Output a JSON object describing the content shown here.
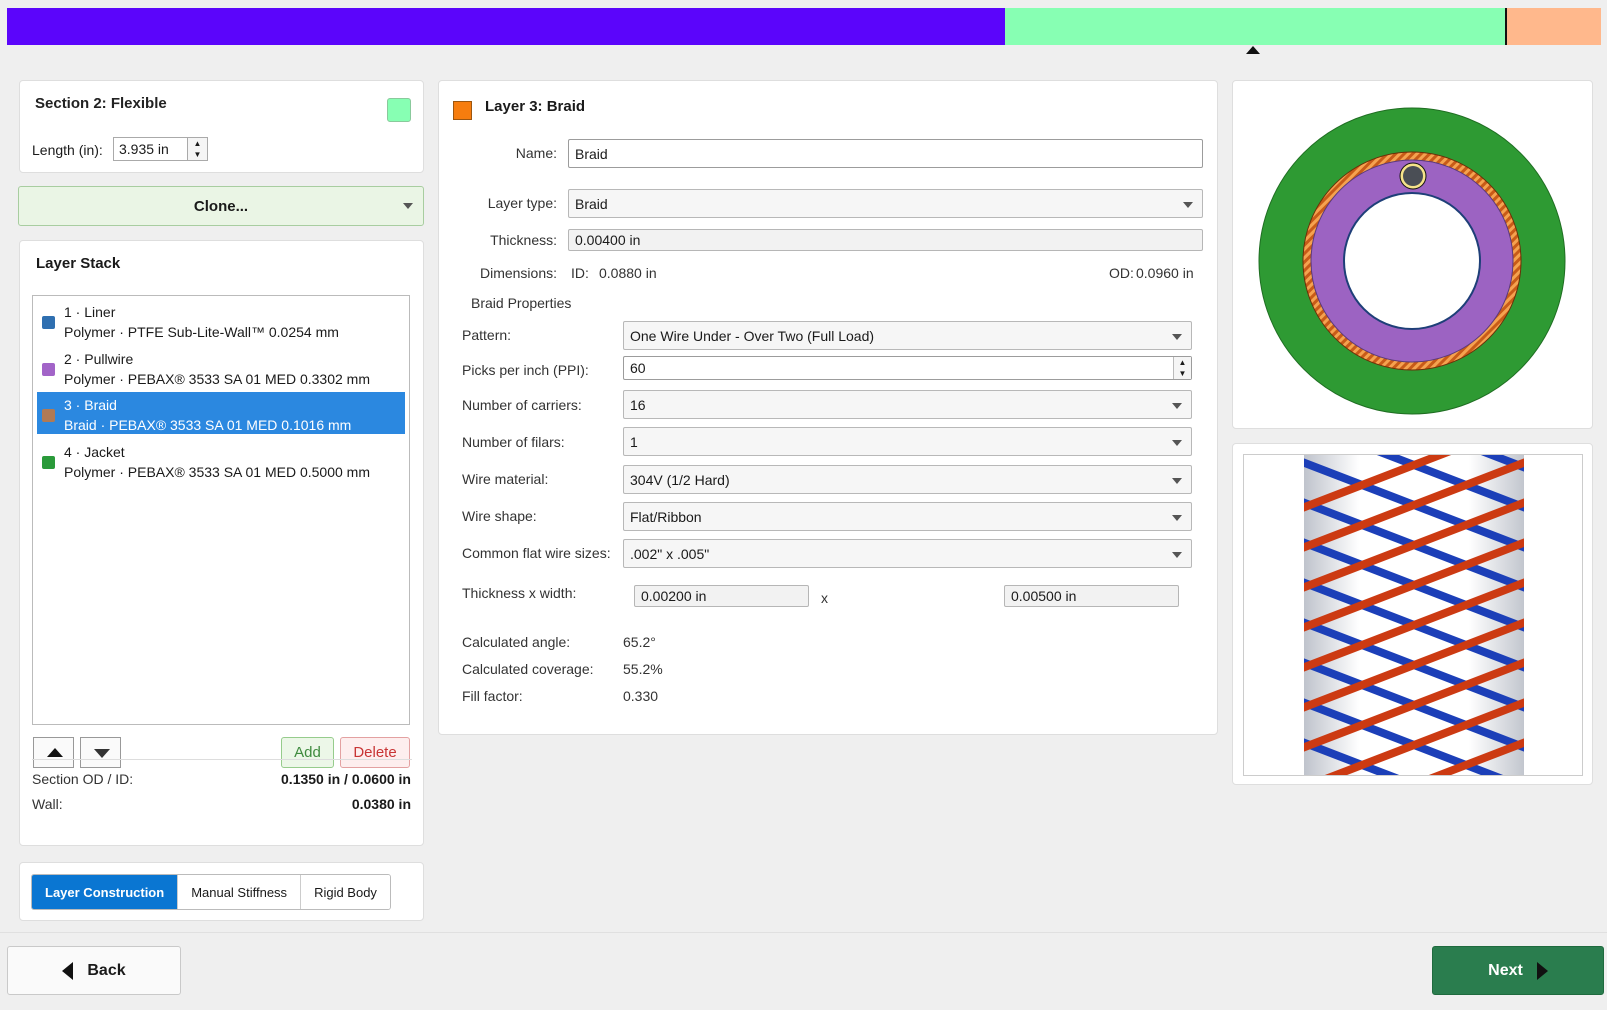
{
  "progress": {
    "segments": [
      {
        "color": "#5b05fb"
      },
      {
        "color": "#87ffb3"
      },
      {
        "color": "#ffb88c"
      }
    ],
    "active_segment": 2
  },
  "section": {
    "title": "Section 2: Flexible",
    "color": "#87ffb3",
    "length_label": "Length (in):",
    "length_value": "3.935 in"
  },
  "clone": {
    "label": "Clone..."
  },
  "stack": {
    "title": "Layer Stack",
    "items": [
      {
        "line1": "1 · Liner",
        "line2": "Polymer · PTFE Sub-Lite-Wall™   0.0254 mm",
        "color": "#2f6fb0",
        "selected": false
      },
      {
        "line1": "2 · Pullwire",
        "line2": "Polymer · PEBAX® 3533 SA 01 MED   0.3302 mm",
        "color": "#a264c8",
        "selected": false
      },
      {
        "line1": "3 · Braid",
        "line2": "Braid · PEBAX® 3533 SA 01 MED   0.1016 mm",
        "color": "#b07a55",
        "selected": true
      },
      {
        "line1": "4 · Jacket",
        "line2": "Polymer · PEBAX® 3533 SA 01 MED   0.5000 mm",
        "color": "#2a9a3a",
        "selected": false
      }
    ],
    "add_label": "Add",
    "delete_label": "Delete",
    "od_id_label": "Section OD / ID:",
    "od_id_value": "0.1350 in / 0.0600 in",
    "wall_label": "Wall:",
    "wall_value": "0.0380 in"
  },
  "tabs": [
    {
      "label": "Layer Construction",
      "active": true
    },
    {
      "label": "Manual Stiffness",
      "active": false
    },
    {
      "label": "Rigid Body",
      "active": false
    }
  ],
  "layer": {
    "title": "Layer 3: Braid",
    "color": "#f77d0e",
    "name_label": "Name:",
    "name_value": "Braid",
    "type_label": "Layer type:",
    "type_value": "Braid",
    "thickness_label": "Thickness:",
    "thickness_value": "0.00400 in",
    "dimensions_label": "Dimensions:",
    "id_label": "ID:",
    "id_value": "0.0880 in",
    "od_label": "OD:",
    "od_value": "0.0960 in"
  },
  "braid": {
    "section_label": "Braid Properties",
    "pattern_label": "Pattern:",
    "pattern_value": "One Wire Under - Over Two (Full Load)",
    "ppi_label": "Picks per inch (PPI):",
    "ppi_value": "60",
    "carriers_label": "Number of carriers:",
    "carriers_value": "16",
    "filars_label": "Number of filars:",
    "filars_value": "1",
    "material_label": "Wire material:",
    "material_value": "304V (1/2 Hard)",
    "shape_label": "Wire shape:",
    "shape_value": "Flat/Ribbon",
    "sizes_label": "Common flat wire sizes:",
    "sizes_value": ".002\" x .005\"",
    "tw_label": "Thickness x width:",
    "tw_thickness": "0.00200 in",
    "tw_x": "x",
    "tw_width": "0.00500 in",
    "angle_label": "Calculated angle:",
    "angle_value": "65.2°",
    "coverage_label": "Calculated coverage:",
    "coverage_value": "55.2%",
    "fill_label": "Fill factor:",
    "fill_value": "0.330"
  },
  "nav": {
    "back_label": "Back",
    "next_label": "Next"
  }
}
